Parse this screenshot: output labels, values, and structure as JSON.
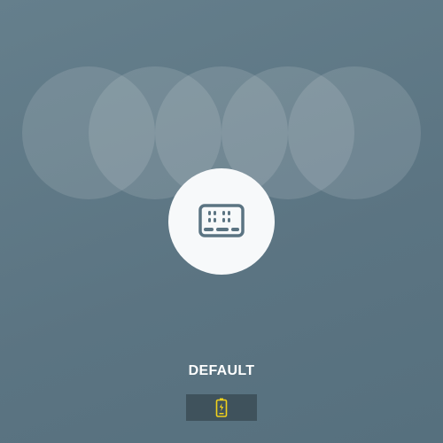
{
  "mode": {
    "label": "DEFAULT",
    "icon": "keypad-icon"
  },
  "status": {
    "icon": "battery-charging-icon",
    "accent_color": "#f2d21b"
  },
  "colors": {
    "background": "#5e7785",
    "disc": "#f7f9fa",
    "icon": "#5b7482"
  }
}
